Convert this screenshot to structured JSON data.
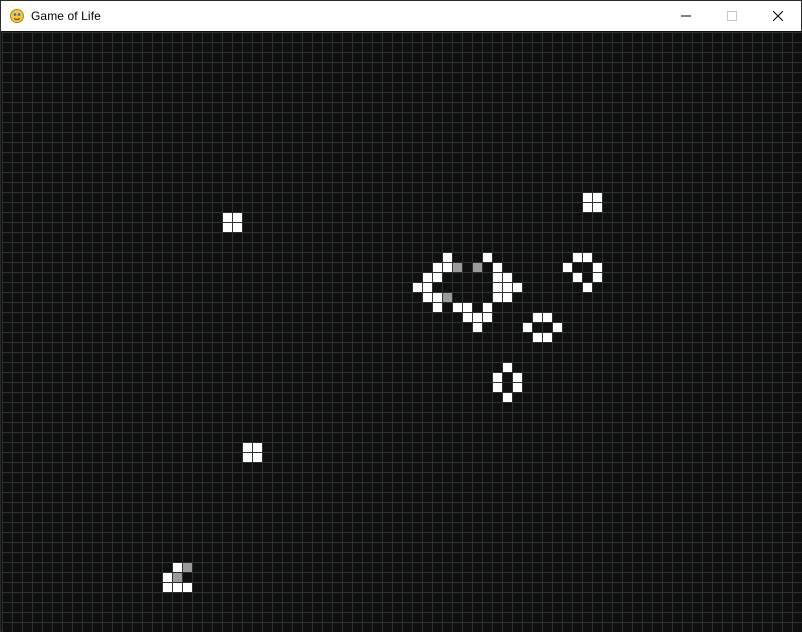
{
  "window": {
    "title": "Game of Life",
    "icon": "pygame-snake-icon",
    "controls": {
      "minimize": "minimize-icon",
      "maximize": "maximize-icon",
      "close": "close-icon"
    }
  },
  "board": {
    "columns": 80,
    "rows": 60,
    "colors": {
      "background": "#0f0f0f",
      "grid": "#2a332d",
      "alive": "#ffffff",
      "dying": "#9a9a9a"
    },
    "alive_cells": [
      [
        58,
        16
      ],
      [
        59,
        16
      ],
      [
        58,
        17
      ],
      [
        59,
        17
      ],
      [
        22,
        18
      ],
      [
        23,
        18
      ],
      [
        22,
        19
      ],
      [
        23,
        19
      ],
      [
        44,
        22
      ],
      [
        48,
        22
      ],
      [
        57,
        22
      ],
      [
        58,
        22
      ],
      [
        43,
        23
      ],
      [
        44,
        23
      ],
      [
        47,
        23
      ],
      [
        49,
        23
      ],
      [
        56,
        23
      ],
      [
        59,
        23
      ],
      [
        42,
        24
      ],
      [
        43,
        24
      ],
      [
        49,
        24
      ],
      [
        50,
        24
      ],
      [
        57,
        24
      ],
      [
        59,
        24
      ],
      [
        41,
        25
      ],
      [
        42,
        25
      ],
      [
        49,
        25
      ],
      [
        50,
        25
      ],
      [
        51,
        25
      ],
      [
        58,
        25
      ],
      [
        42,
        26
      ],
      [
        43,
        26
      ],
      [
        49,
        26
      ],
      [
        50,
        26
      ],
      [
        43,
        27
      ],
      [
        45,
        27
      ],
      [
        46,
        27
      ],
      [
        48,
        27
      ],
      [
        46,
        28
      ],
      [
        47,
        28
      ],
      [
        48,
        28
      ],
      [
        53,
        28
      ],
      [
        54,
        28
      ],
      [
        47,
        29
      ],
      [
        52,
        29
      ],
      [
        55,
        29
      ],
      [
        53,
        30
      ],
      [
        54,
        30
      ],
      [
        50,
        33
      ],
      [
        49,
        34
      ],
      [
        51,
        34
      ],
      [
        49,
        35
      ],
      [
        51,
        35
      ],
      [
        50,
        36
      ],
      [
        24,
        41
      ],
      [
        25,
        41
      ],
      [
        24,
        42
      ],
      [
        25,
        42
      ],
      [
        16,
        54
      ],
      [
        16,
        55
      ],
      [
        17,
        55
      ],
      [
        18,
        55
      ]
    ],
    "dying_cells": [
      [
        45,
        23
      ],
      [
        47,
        23
      ],
      [
        44,
        26
      ],
      [
        18,
        53
      ],
      [
        17,
        54
      ]
    ],
    "extra_alive": [
      [
        17,
        53
      ]
    ]
  }
}
